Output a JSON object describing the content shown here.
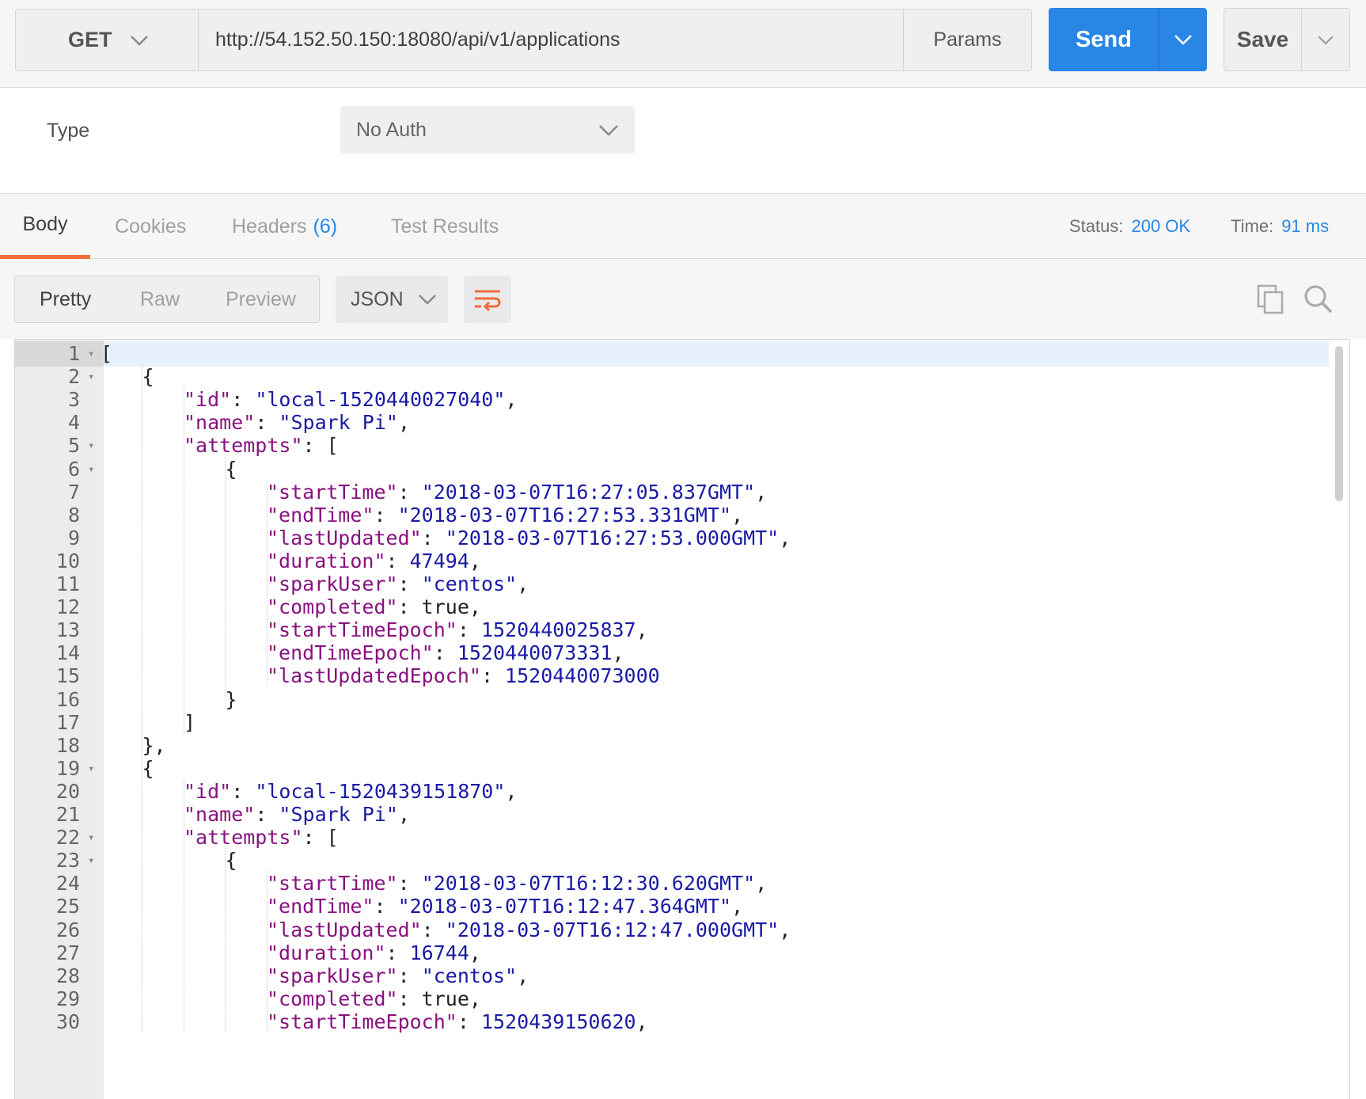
{
  "request": {
    "method": "GET",
    "url": "http://54.152.50.150:18080/api/v1/applications",
    "params_label": "Params",
    "send_label": "Send",
    "save_label": "Save"
  },
  "auth": {
    "type_label": "Type",
    "selected": "No Auth"
  },
  "response_tabs": {
    "body": "Body",
    "cookies": "Cookies",
    "headers": "Headers",
    "headers_count": "(6)",
    "tests": "Test Results"
  },
  "status": {
    "status_label": "Status:",
    "status_value": "200 OK",
    "time_label": "Time:",
    "time_value": "91 ms"
  },
  "toolbar": {
    "pretty": "Pretty",
    "raw": "Raw",
    "preview": "Preview",
    "format": "JSON"
  },
  "icons": {
    "wrap": "wrap-lines-icon",
    "copy": "copy-icon",
    "search": "search-icon"
  },
  "colors": {
    "accent": "#2a86e4",
    "tab_underline": "#f26b3a",
    "json_key": "#881280",
    "json_string": "#1a1aa6"
  },
  "code_lines": [
    {
      "n": "1",
      "fold": true,
      "indent": 0,
      "parts": [
        [
          "p",
          "["
        ]
      ]
    },
    {
      "n": "2",
      "fold": true,
      "indent": 1,
      "parts": [
        [
          "p",
          "{"
        ]
      ]
    },
    {
      "n": "3",
      "fold": false,
      "indent": 2,
      "parts": [
        [
          "k",
          "\"id\""
        ],
        [
          "p",
          ": "
        ],
        [
          "s",
          "\"local-1520440027040\""
        ],
        [
          "p",
          ","
        ]
      ]
    },
    {
      "n": "4",
      "fold": false,
      "indent": 2,
      "parts": [
        [
          "k",
          "\"name\""
        ],
        [
          "p",
          ": "
        ],
        [
          "s",
          "\"Spark Pi\""
        ],
        [
          "p",
          ","
        ]
      ]
    },
    {
      "n": "5",
      "fold": true,
      "indent": 2,
      "parts": [
        [
          "k",
          "\"attempts\""
        ],
        [
          "p",
          ": ["
        ]
      ]
    },
    {
      "n": "6",
      "fold": true,
      "indent": 3,
      "parts": [
        [
          "p",
          "{"
        ]
      ]
    },
    {
      "n": "7",
      "fold": false,
      "indent": 4,
      "parts": [
        [
          "k",
          "\"startTime\""
        ],
        [
          "p",
          ": "
        ],
        [
          "s",
          "\"2018-03-07T16:27:05.837GMT\""
        ],
        [
          "p",
          ","
        ]
      ]
    },
    {
      "n": "8",
      "fold": false,
      "indent": 4,
      "parts": [
        [
          "k",
          "\"endTime\""
        ],
        [
          "p",
          ": "
        ],
        [
          "s",
          "\"2018-03-07T16:27:53.331GMT\""
        ],
        [
          "p",
          ","
        ]
      ]
    },
    {
      "n": "9",
      "fold": false,
      "indent": 4,
      "parts": [
        [
          "k",
          "\"lastUpdated\""
        ],
        [
          "p",
          ": "
        ],
        [
          "s",
          "\"2018-03-07T16:27:53.000GMT\""
        ],
        [
          "p",
          ","
        ]
      ]
    },
    {
      "n": "10",
      "fold": false,
      "indent": 4,
      "parts": [
        [
          "k",
          "\"duration\""
        ],
        [
          "p",
          ": "
        ],
        [
          "n",
          "47494"
        ],
        [
          "p",
          ","
        ]
      ]
    },
    {
      "n": "11",
      "fold": false,
      "indent": 4,
      "parts": [
        [
          "k",
          "\"sparkUser\""
        ],
        [
          "p",
          ": "
        ],
        [
          "s",
          "\"centos\""
        ],
        [
          "p",
          ","
        ]
      ]
    },
    {
      "n": "12",
      "fold": false,
      "indent": 4,
      "parts": [
        [
          "k",
          "\"completed\""
        ],
        [
          "p",
          ": true,"
        ]
      ]
    },
    {
      "n": "13",
      "fold": false,
      "indent": 4,
      "parts": [
        [
          "k",
          "\"startTimeEpoch\""
        ],
        [
          "p",
          ": "
        ],
        [
          "n",
          "1520440025837"
        ],
        [
          "p",
          ","
        ]
      ]
    },
    {
      "n": "14",
      "fold": false,
      "indent": 4,
      "parts": [
        [
          "k",
          "\"endTimeEpoch\""
        ],
        [
          "p",
          ": "
        ],
        [
          "n",
          "1520440073331"
        ],
        [
          "p",
          ","
        ]
      ]
    },
    {
      "n": "15",
      "fold": false,
      "indent": 4,
      "parts": [
        [
          "k",
          "\"lastUpdatedEpoch\""
        ],
        [
          "p",
          ": "
        ],
        [
          "n",
          "1520440073000"
        ]
      ]
    },
    {
      "n": "16",
      "fold": false,
      "indent": 3,
      "parts": [
        [
          "p",
          "}"
        ]
      ]
    },
    {
      "n": "17",
      "fold": false,
      "indent": 2,
      "parts": [
        [
          "p",
          "]"
        ]
      ]
    },
    {
      "n": "18",
      "fold": false,
      "indent": 1,
      "parts": [
        [
          "p",
          "},"
        ]
      ]
    },
    {
      "n": "19",
      "fold": true,
      "indent": 1,
      "parts": [
        [
          "p",
          "{"
        ]
      ]
    },
    {
      "n": "20",
      "fold": false,
      "indent": 2,
      "parts": [
        [
          "k",
          "\"id\""
        ],
        [
          "p",
          ": "
        ],
        [
          "s",
          "\"local-1520439151870\""
        ],
        [
          "p",
          ","
        ]
      ]
    },
    {
      "n": "21",
      "fold": false,
      "indent": 2,
      "parts": [
        [
          "k",
          "\"name\""
        ],
        [
          "p",
          ": "
        ],
        [
          "s",
          "\"Spark Pi\""
        ],
        [
          "p",
          ","
        ]
      ]
    },
    {
      "n": "22",
      "fold": true,
      "indent": 2,
      "parts": [
        [
          "k",
          "\"attempts\""
        ],
        [
          "p",
          ": ["
        ]
      ]
    },
    {
      "n": "23",
      "fold": true,
      "indent": 3,
      "parts": [
        [
          "p",
          "{"
        ]
      ]
    },
    {
      "n": "24",
      "fold": false,
      "indent": 4,
      "parts": [
        [
          "k",
          "\"startTime\""
        ],
        [
          "p",
          ": "
        ],
        [
          "s",
          "\"2018-03-07T16:12:30.620GMT\""
        ],
        [
          "p",
          ","
        ]
      ]
    },
    {
      "n": "25",
      "fold": false,
      "indent": 4,
      "parts": [
        [
          "k",
          "\"endTime\""
        ],
        [
          "p",
          ": "
        ],
        [
          "s",
          "\"2018-03-07T16:12:47.364GMT\""
        ],
        [
          "p",
          ","
        ]
      ]
    },
    {
      "n": "26",
      "fold": false,
      "indent": 4,
      "parts": [
        [
          "k",
          "\"lastUpdated\""
        ],
        [
          "p",
          ": "
        ],
        [
          "s",
          "\"2018-03-07T16:12:47.000GMT\""
        ],
        [
          "p",
          ","
        ]
      ]
    },
    {
      "n": "27",
      "fold": false,
      "indent": 4,
      "parts": [
        [
          "k",
          "\"duration\""
        ],
        [
          "p",
          ": "
        ],
        [
          "n",
          "16744"
        ],
        [
          "p",
          ","
        ]
      ]
    },
    {
      "n": "28",
      "fold": false,
      "indent": 4,
      "parts": [
        [
          "k",
          "\"sparkUser\""
        ],
        [
          "p",
          ": "
        ],
        [
          "s",
          "\"centos\""
        ],
        [
          "p",
          ","
        ]
      ]
    },
    {
      "n": "29",
      "fold": false,
      "indent": 4,
      "parts": [
        [
          "k",
          "\"completed\""
        ],
        [
          "p",
          ": true,"
        ]
      ]
    },
    {
      "n": "30",
      "fold": false,
      "indent": 4,
      "parts": [
        [
          "k",
          "\"startTimeEpoch\""
        ],
        [
          "p",
          ": "
        ],
        [
          "n",
          "1520439150620"
        ],
        [
          "p",
          ","
        ]
      ]
    }
  ]
}
